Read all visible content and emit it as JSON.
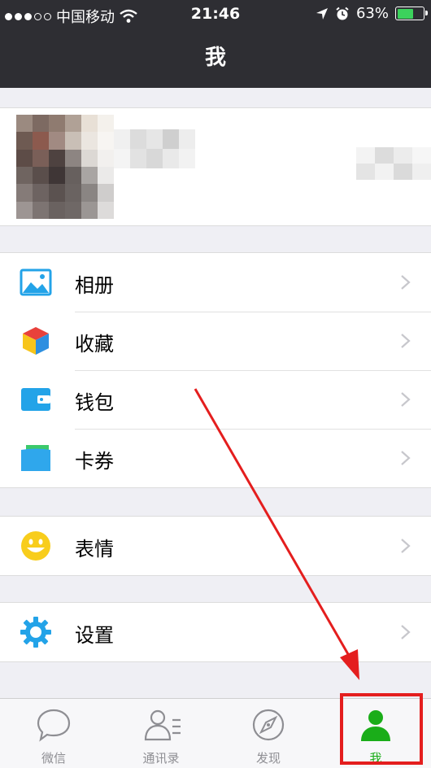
{
  "status_bar": {
    "carrier": "中国移动",
    "time": "21:46",
    "battery_percent": "63%",
    "battery_level": 0.63
  },
  "nav": {
    "title": "我"
  },
  "menu": {
    "group1": [
      {
        "label": "相册",
        "icon": "photo-album-icon"
      },
      {
        "label": "收藏",
        "icon": "favorites-cube-icon"
      },
      {
        "label": "钱包",
        "icon": "wallet-icon"
      },
      {
        "label": "卡券",
        "icon": "card-coupon-icon"
      }
    ],
    "group2": [
      {
        "label": "表情",
        "icon": "smiley-icon"
      }
    ],
    "group3": [
      {
        "label": "设置",
        "icon": "gear-icon"
      }
    ]
  },
  "tabbar": [
    {
      "label": "微信",
      "icon": "chat-bubble-icon",
      "active": false
    },
    {
      "label": "通讯录",
      "icon": "contacts-icon",
      "active": false
    },
    {
      "label": "发现",
      "icon": "compass-icon",
      "active": false
    },
    {
      "label": "我",
      "icon": "me-person-icon",
      "active": true
    }
  ],
  "colors": {
    "header_bg": "#2e2e33",
    "accent_green": "#1aad19",
    "annotation_red": "#e41e1e",
    "icon_blue": "#23a3e8"
  }
}
